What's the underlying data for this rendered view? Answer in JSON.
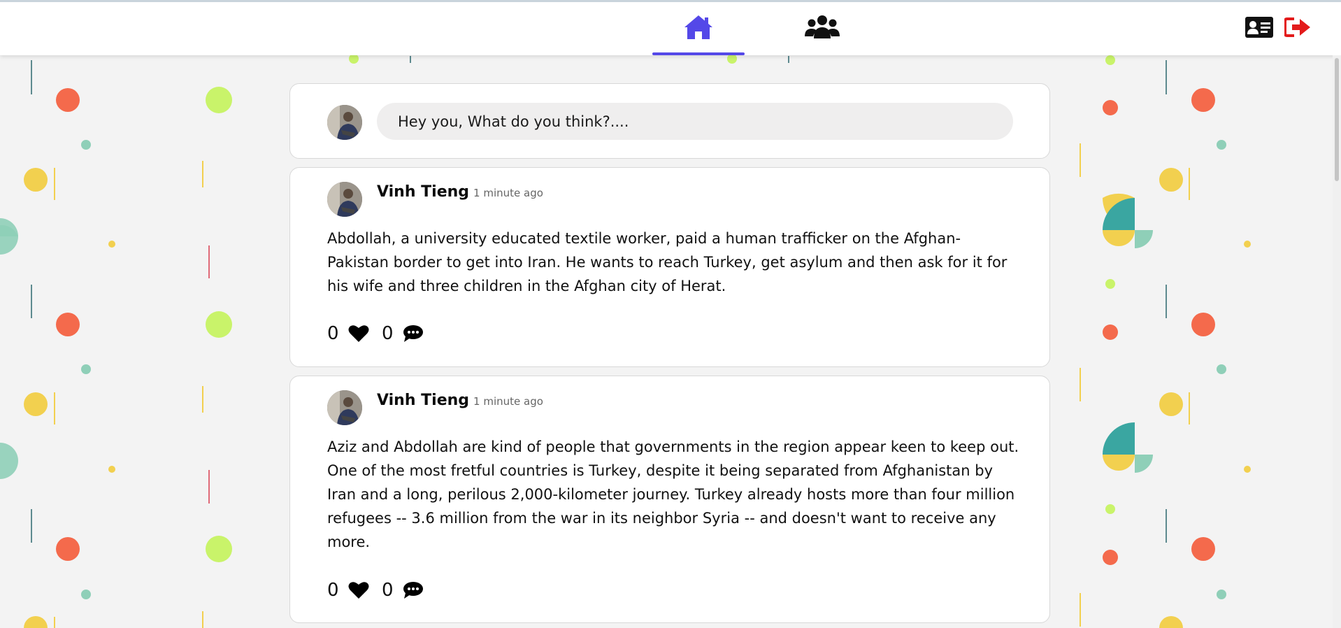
{
  "nav": {
    "active_tab": "home",
    "accent_color": "#5448e8",
    "logout_color": "#e31b1b",
    "icons": [
      "home-icon",
      "friends-icon",
      "profile-card-icon",
      "logout-icon"
    ]
  },
  "composer": {
    "placeholder": "Hey you, What do you think?...."
  },
  "posts": [
    {
      "author": "Vinh Tieng",
      "time": "1 minute ago",
      "text": "Abdollah, a university educated textile worker, paid a human trafficker on the Afghan-Pakistan border to get into Iran. He wants to reach Turkey, get asylum and then ask for it for his wife and three children in the Afghan city of Herat.",
      "likes": "0",
      "comments": "0"
    },
    {
      "author": "Vinh Tieng",
      "time": "1 minute ago",
      "text": "Aziz and Abdollah are kind of people that governments in the region appear keen to keep out. One of the most fretful countries is Turkey, despite it being separated from Afghanistan by Iran and a long, perilous 2,000-kilometer journey. Turkey already hosts more than four million refugees -- 3.6 million from the war in its neighbor Syria -- and doesn't want to receive any more.",
      "likes": "0",
      "comments": "0"
    }
  ]
}
